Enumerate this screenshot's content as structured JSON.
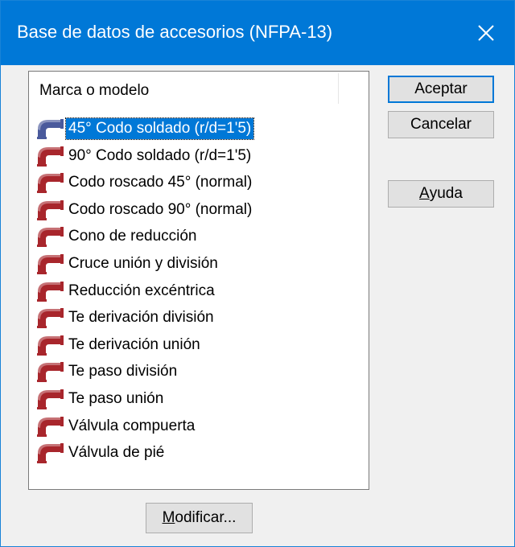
{
  "window": {
    "title": "Base de datos de accesorios (NFPA-13)",
    "close_glyph": "✕"
  },
  "list": {
    "column_header": "Marca o modelo",
    "items": [
      {
        "label": "45° Codo soldado (r/d=1'5)",
        "icon": "pipe-elbow-icon",
        "color": "#4a5a9c",
        "selected": true
      },
      {
        "label": "90° Codo soldado (r/d=1'5)",
        "icon": "pipe-elbow-icon",
        "color": "#a8262c"
      },
      {
        "label": "Codo roscado 45° (normal)",
        "icon": "pipe-elbow-icon",
        "color": "#a8262c"
      },
      {
        "label": "Codo roscado 90° (normal)",
        "icon": "pipe-elbow-icon",
        "color": "#a8262c"
      },
      {
        "label": "Cono de reducción",
        "icon": "pipe-elbow-icon",
        "color": "#a8262c"
      },
      {
        "label": "Cruce unión y división",
        "icon": "pipe-elbow-icon",
        "color": "#a8262c"
      },
      {
        "label": "Reducción excéntrica",
        "icon": "pipe-elbow-icon",
        "color": "#a8262c"
      },
      {
        "label": "Te derivación división",
        "icon": "pipe-elbow-icon",
        "color": "#a8262c"
      },
      {
        "label": "Te derivación unión",
        "icon": "pipe-elbow-icon",
        "color": "#a8262c"
      },
      {
        "label": "Te paso división",
        "icon": "pipe-elbow-icon",
        "color": "#a8262c"
      },
      {
        "label": "Te paso unión",
        "icon": "pipe-elbow-icon",
        "color": "#a8262c"
      },
      {
        "label": "Válvula compuerta",
        "icon": "pipe-elbow-icon",
        "color": "#a8262c"
      },
      {
        "label": "Válvula de pié",
        "icon": "pipe-elbow-icon",
        "color": "#a8262c"
      }
    ]
  },
  "buttons": {
    "accept": "Aceptar",
    "cancel": "Cancelar",
    "help_mnemonic": "A",
    "help_rest": "yuda",
    "modify_mnemonic": "M",
    "modify_rest": "odificar..."
  },
  "colors": {
    "titlebar": "#0078d7",
    "selection": "#0078d7",
    "dialog_bg": "#f0f0f0"
  }
}
